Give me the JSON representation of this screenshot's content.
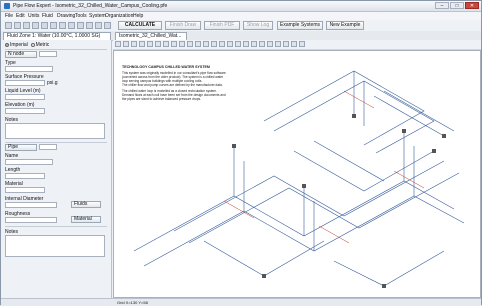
{
  "window": {
    "title": "Pipe Flow Expert - Isometric_32_Chilled_Water_Campus_Cooling.pfe",
    "min": "–",
    "max": "□",
    "close": "✕"
  },
  "menu": [
    "File",
    "Edit",
    "Units",
    "Fluid",
    "Drawing",
    "Tools",
    "System",
    "Organization",
    "Help"
  ],
  "toolbar": {
    "calculate": "CALCULATE",
    "finish_draw": "Finish Draw",
    "finish_pdf": "Finish PDF",
    "show_log": "Show Log",
    "example_systems": "Example Systems",
    "new_example": "New Example"
  },
  "tabs": {
    "fluid_zone": "Fluid Zone 1: Water (10.00°C, 1.0000 SG)",
    "doc": "Isometric_32_Chilled_Wat..."
  },
  "left_panel": {
    "node_label": "N node",
    "type_label": "Type",
    "surface_pressure_label": "Surface Pressure",
    "surface_pressure_unit": "psi.g",
    "liquid_level_label": "Liquid Level (m)",
    "elevation_label": "Elevation (m)",
    "notes_label": "Notes",
    "imperial": "Imperial",
    "metric": "Metric",
    "pipe_label": "Pipe",
    "name_label": "Name",
    "length_label": "Length",
    "material_label": "Material",
    "internal_diameter_label": "Internal Diameter",
    "roughness_label": "Roughness",
    "fluids_button": "Fluids",
    "material_button": "Material",
    "notes2_label": "Notes"
  },
  "drawing_notes": {
    "heading": "TECHNOLOGY CAMPUS CHILLED WATER SYSTEM",
    "lines": [
      "This system was originally modelled in our consultant's pipe flow software",
      "(converted across from the older product). The system is a chilled water",
      "loop serving campus buildings with multiple cooling coils.",
      "The chiller flow and pump curves are defined by the manufacturer data."
    ],
    "lines2": [
      "The chilled water loop is modelled as a closed recirculation system.",
      "Demand flows at each coil have been set from the design documents and",
      "the pipes are sized to achieve balanced pressure drops."
    ]
  },
  "status": {
    "coords": "Grid  X=130  Y=58"
  }
}
